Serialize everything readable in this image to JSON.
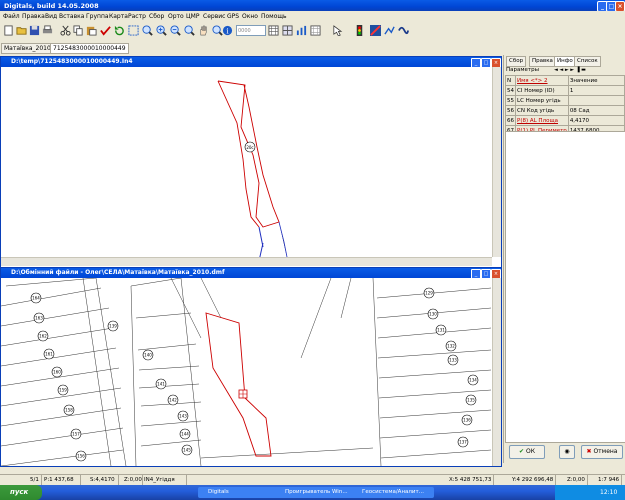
{
  "app": {
    "title": "Digitals, build 14.05.2008"
  },
  "menu": [
    "Файл",
    "Правка",
    "Вид",
    "Вставка",
    "Группа",
    "Карта",
    "Растр",
    "Сбор",
    "Орто",
    "ЦМР",
    "Сервис",
    "GPS",
    "Окно",
    "Помощь"
  ],
  "toolbar": {
    "zoom_value": "0000"
  },
  "doc_tabs": [
    "Матаївка_2010",
    "7125483000010000449"
  ],
  "window1": {
    "title": "D:\\temp\\7125483000010000449.In4",
    "parcel_label": "20с"
  },
  "window2": {
    "title": "D:\\Обмінний файли - Олег\\СЕЛА\\Матаївка\\Матаївка_2010.dmf",
    "parcels_left": [
      "164",
      "163",
      "162",
      "161",
      "160",
      "159",
      "158",
      "157",
      "156"
    ],
    "parcels_mid": [
      "139",
      "140",
      "141",
      "142",
      "143",
      "144",
      "145"
    ],
    "parcels_right": [
      "129",
      "130",
      "131",
      "132",
      "133",
      "134",
      "135",
      "136",
      "137"
    ]
  },
  "panel": {
    "tabs": [
      "Сбор",
      "Правка",
      "Инфо",
      "Список"
    ],
    "active_tab": "Инфо",
    "subheader": "Параметры",
    "columns": [
      "N",
      "Имя <*> 2",
      "Значение"
    ],
    "rows": [
      {
        "n": "54",
        "name": "CI Номер (ID)",
        "value": "1"
      },
      {
        "n": "55",
        "name": "LC Номер угідь",
        "value": ""
      },
      {
        "n": "56",
        "name": "CN Код угідь",
        "value": "08 Сад"
      },
      {
        "n": "66",
        "name": "P(8) AL Площа",
        "value": "4,4170"
      },
      {
        "n": "67",
        "name": "P(1) PL Периметр",
        "value": "1437,6800"
      }
    ],
    "ok_label": "ОК",
    "cancel_label": "Отмена"
  },
  "status": {
    "page": "5/1",
    "perimeter": "P:1 437,68",
    "area": "S:4,4170",
    "z": "Z:0,00",
    "layer": "IN4_Угіддя",
    "x": "X:5 428 751,73",
    "y": "Y:4 292 696,48",
    "z2": "Z:0,00",
    "scale": "1:7 946"
  },
  "taskbar": {
    "start_label": "пуск",
    "tasks": [
      "Digitals",
      "Проигрыватель Win...",
      "Геосистема/Аналит..."
    ],
    "lang": "UK",
    "clock": "12:10"
  },
  "colors": {
    "accent": "#0a3fb8",
    "parcel_highlight": "#cc0000"
  }
}
